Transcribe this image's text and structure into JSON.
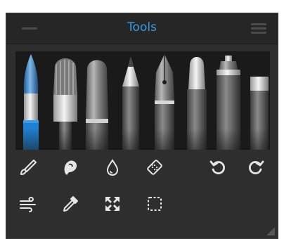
{
  "panel": {
    "title": "Tools",
    "accent": "#3a9be6",
    "icon_color": "#e6e6e6"
  },
  "brushes": {
    "items": [
      "watercolor-brush",
      "flat-brush",
      "filbert-brush",
      "pencil",
      "ink-pen",
      "pastel",
      "airbrush",
      "eraser"
    ],
    "selected": "watercolor-brush"
  },
  "tools": {
    "row1": [
      "brush-icon",
      "smudge-icon",
      "water-drop-icon",
      "eraser-icon",
      "undo-icon",
      "redo-icon"
    ],
    "row2": [
      "wind-blender-icon",
      "eyedropper-icon",
      "transform-icon",
      "selection-icon"
    ]
  }
}
